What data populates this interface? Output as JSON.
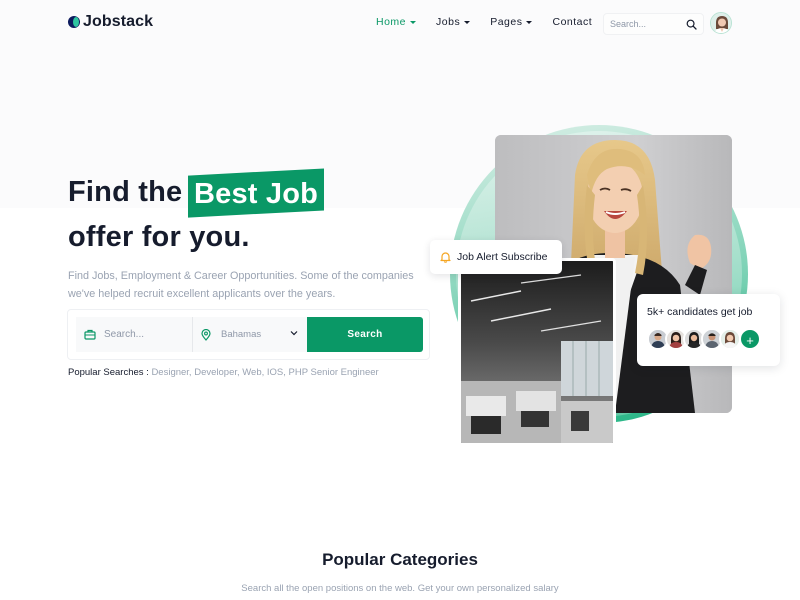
{
  "brand": {
    "name": "Jobstack"
  },
  "nav": {
    "items": [
      {
        "label": "Home",
        "active": true,
        "dropdown": true
      },
      {
        "label": "Jobs",
        "active": false,
        "dropdown": true
      },
      {
        "label": "Pages",
        "active": false,
        "dropdown": true
      },
      {
        "label": "Contact",
        "active": false,
        "dropdown": false
      }
    ],
    "search_placeholder": "Search..."
  },
  "hero": {
    "title_prefix": "Find the",
    "title_highlight": "Best Job",
    "title_suffix": "offer for you.",
    "description": "Find Jobs, Employment & Career Opportunities. Some of the companies we've helped recruit excellent applicants over the years.",
    "search": {
      "keyword_placeholder": "Search...",
      "location_value": "Bahamas",
      "button_label": "Search"
    },
    "popular_label": "Popular Searches :",
    "popular_terms": "Designer, Developer, Web, IOS, PHP Senior Engineer",
    "alert_card_label": "Job Alert Subscribe",
    "candidates_label": "5k+ candidates get job",
    "candidates_plus": "+"
  },
  "categories": {
    "title": "Popular Categories",
    "subtitle": "Search all the open positions on the web. Get your own personalized salary"
  },
  "colors": {
    "accent": "#0a9866",
    "text_dark": "#161c2d",
    "text_muted": "#9aa3b2",
    "alert_bell": "#f5a623"
  },
  "icons": {
    "nav_search": "search-icon",
    "keyword_field": "briefcase-icon",
    "location_field": "map-pin-icon",
    "location_dropdown": "chevron-down-icon",
    "alert": "bell-icon"
  }
}
